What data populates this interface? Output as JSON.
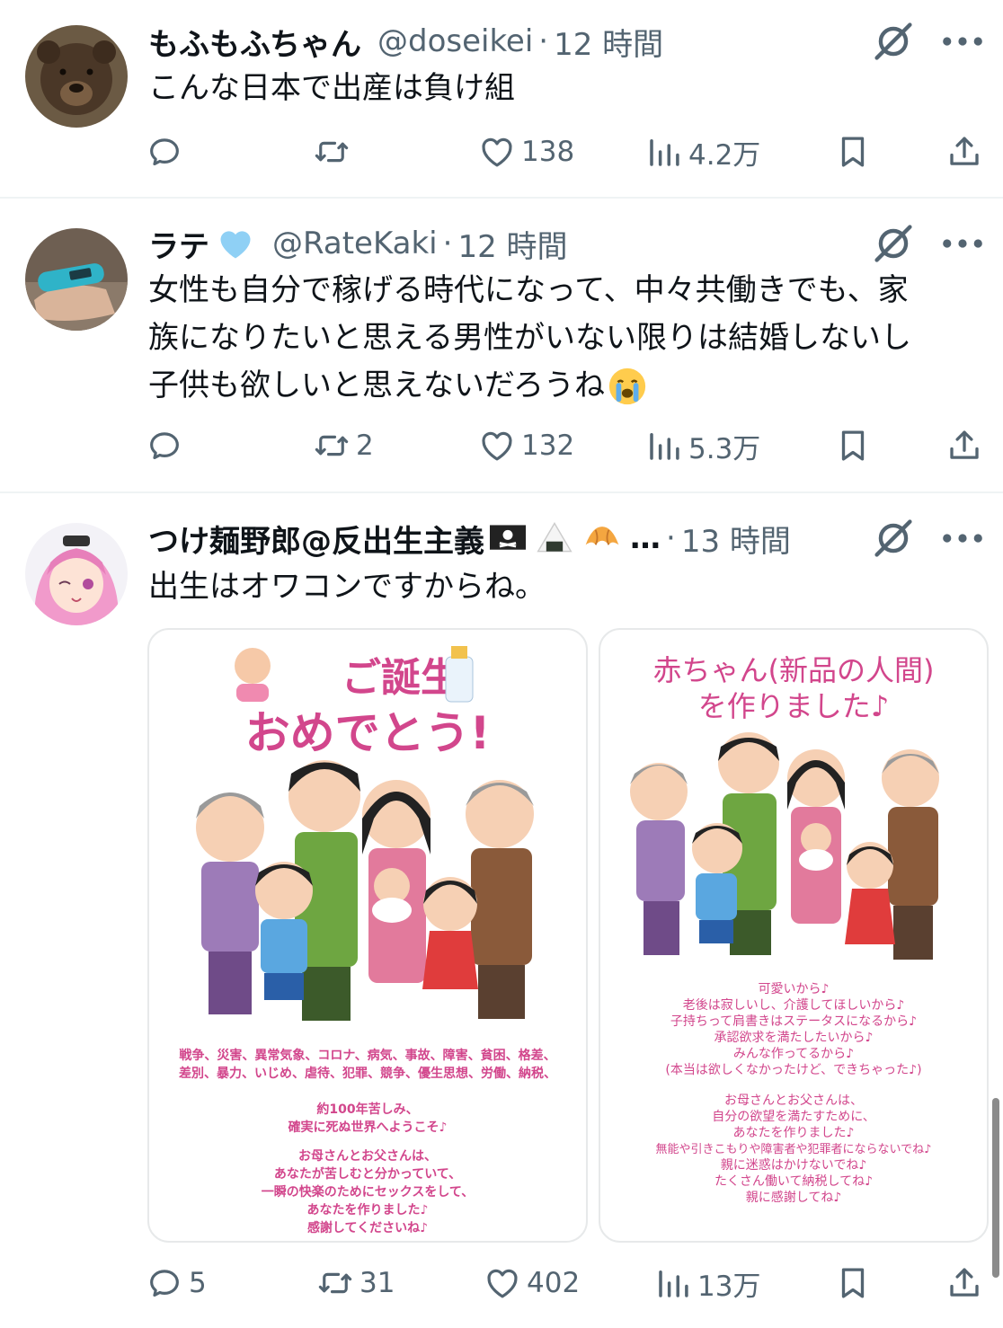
{
  "tweets": [
    {
      "name": "もふもふちゃん",
      "handle": "@doseikei",
      "dot": "·",
      "time": "12 時間",
      "text_lines": [
        "こんな日本で出産は負け組"
      ],
      "replies": "",
      "retweets": "",
      "likes": "138",
      "views": "4.2万"
    },
    {
      "name": "ラテ",
      "handle": "@RateKaki",
      "dot": "·",
      "time": "12 時間",
      "text_lines": [
        "女性も自分で稼げる時代になって、中々共働きでも、家",
        "族になりたいと思える男性がいない限りは結婚しないし",
        "子供も欲しいと思えないだろうね"
      ],
      "replies": "",
      "retweets": "2",
      "likes": "132",
      "views": "5.3万"
    },
    {
      "name": "つけ麺野郎@反出生主義",
      "ellipsis": "…",
      "dot": "·",
      "time": "13 時間",
      "text_lines": [
        "出生はオワコンですからね。"
      ],
      "replies": "5",
      "retweets": "31",
      "likes": "402",
      "views": "13万"
    }
  ],
  "images": {
    "left": {
      "title_1": "ご誕生",
      "title_2": "おめでとう!",
      "caption_lines": [
        "戦争、災害、異常気象、コロナ、病気、事故、障害、貧困、格差、",
        "差別、暴力、いじめ、虐待、犯罪、競争、優生思想、労働、納税、",
        "",
        "約100年苦しみ、",
        "確実に死ぬ世界へようこそ♪",
        "",
        "お母さんとお父さんは、",
        "あなたが苦しむと分かっていて、",
        "一瞬の快楽のためにセックスをして、",
        "あなたを作りました♪",
        "感謝してくださいね♪"
      ]
    },
    "right": {
      "title_1": "赤ちゃん(新品の人間)",
      "title_2": "を作りました♪",
      "caption_lines": [
        "可愛いから♪",
        "老後は寂しいし、介護してほしいから♪",
        "子持ちって肩書きはステータスになるから♪",
        "承認欲求を満たしたいから♪",
        "みんな作ってるから♪",
        "(本当は欲しくなかったけど、できちゃった♪)",
        "",
        "お母さんとお父さんは、",
        "自分の欲望を満たすために、",
        "あなたを作りました♪",
        "無能や引きこもりや障害者や犯罪者にならないでね♪",
        "親に迷惑はかけないでね♪",
        "たくさん働いて納税してね♪",
        "親に感謝してね♪"
      ]
    }
  },
  "icons": {
    "reply": "reply-icon",
    "retweet": "retweet-icon",
    "like": "heart-icon",
    "views": "views-icon",
    "bookmark": "bookmark-icon",
    "share": "share-icon",
    "grok": "grok-icon",
    "more": "more-icon"
  },
  "colors": {
    "secondary": "#536471",
    "accent_pink": "#d2468c",
    "divider": "#eff3f4"
  }
}
